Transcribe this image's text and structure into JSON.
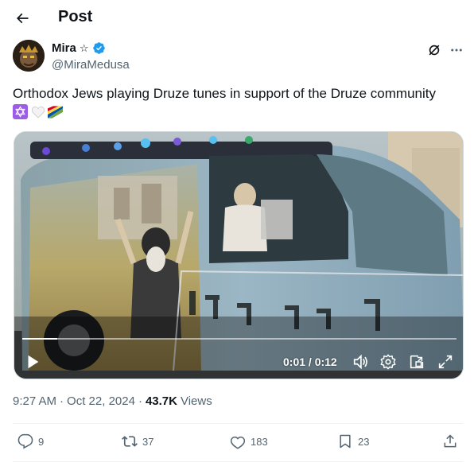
{
  "header": {
    "title": "Post",
    "back_icon": "arrow-left-icon"
  },
  "author": {
    "display_name": "Mira",
    "name_symbol": "☆",
    "handle": "@MiraMedusa",
    "verified_icon": "verified-badge-icon",
    "grok_icon": "grok-icon",
    "more_icon": "more-icon"
  },
  "post": {
    "text": "Orthodox Jews playing Druze tunes in support of the Druze community",
    "emojis": [
      "star-of-david",
      "white-heart",
      "druze-flag"
    ]
  },
  "video": {
    "current_time": "0:01",
    "duration": "0:12",
    "time_label": "0:01 / 0:12",
    "progress": 0.08,
    "controls": [
      "play-icon",
      "volume-icon",
      "settings-icon",
      "picture-in-picture-icon",
      "fullscreen-icon"
    ]
  },
  "meta": {
    "time": "9:27 AM",
    "separator": "·",
    "date": "Oct 22, 2024",
    "views_count": "43.7K",
    "views_label": "Views"
  },
  "actions": {
    "replies": "9",
    "reposts": "37",
    "likes": "183",
    "bookmarks": "23"
  },
  "colors": {
    "text": "#0f1419",
    "secondary": "#536471",
    "verified": "#1d9bf0",
    "divider": "#eff3f4"
  }
}
